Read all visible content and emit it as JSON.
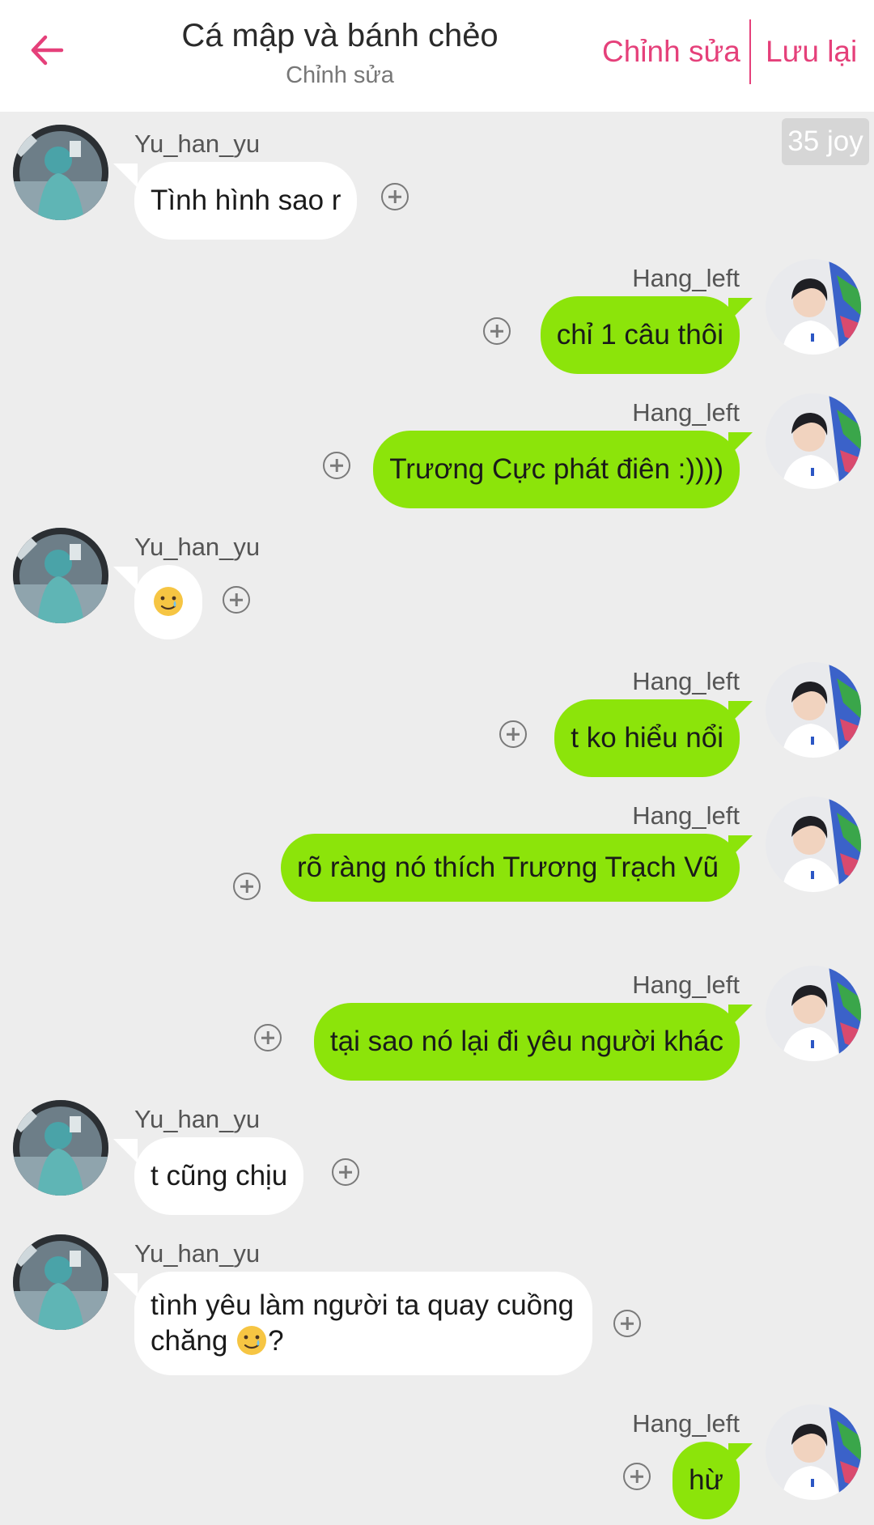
{
  "header": {
    "title": "Cá mập và bánh chẻo",
    "subtitle": "Chỉnh sửa",
    "edit_label": "Chỉnh sửa",
    "save_label": "Lưu lại",
    "back_icon": "arrow-left-icon",
    "accent_color": "#e5407a"
  },
  "joy_badge": "35 joy",
  "colors": {
    "incoming_bubble": "#ffffff",
    "outgoing_bubble": "#8ce40a",
    "background": "#ededed"
  },
  "messages": [
    {
      "sender": "Yu_han_yu",
      "side": "left",
      "text": "Tình hình sao r"
    },
    {
      "sender": "Hang_left",
      "side": "right",
      "text": "chỉ 1 câu thôi"
    },
    {
      "sender": "Hang_left",
      "side": "right",
      "text": "Trương Cực phát điên :))))"
    },
    {
      "sender": "Yu_han_yu",
      "side": "left",
      "text": "",
      "emoji": "smiling-face-with-tear-emoji"
    },
    {
      "sender": "Hang_left",
      "side": "right",
      "text": "t ko hiểu nổi"
    },
    {
      "sender": "Hang_left",
      "side": "right",
      "text": "rõ ràng nó thích Trương Trạch Vũ"
    },
    {
      "sender": "Hang_left",
      "side": "right",
      "text": "tại sao nó lại đi yêu người khác"
    },
    {
      "sender": "Yu_han_yu",
      "side": "left",
      "text": "t cũng chịu"
    },
    {
      "sender": "Yu_han_yu",
      "side": "left",
      "text": "tình yêu làm người ta quay cuồng chăng",
      "text_suffix": "?",
      "emoji": "smiling-face-with-tear-emoji"
    },
    {
      "sender": "Hang_left",
      "side": "right",
      "text": "hừ"
    }
  ]
}
